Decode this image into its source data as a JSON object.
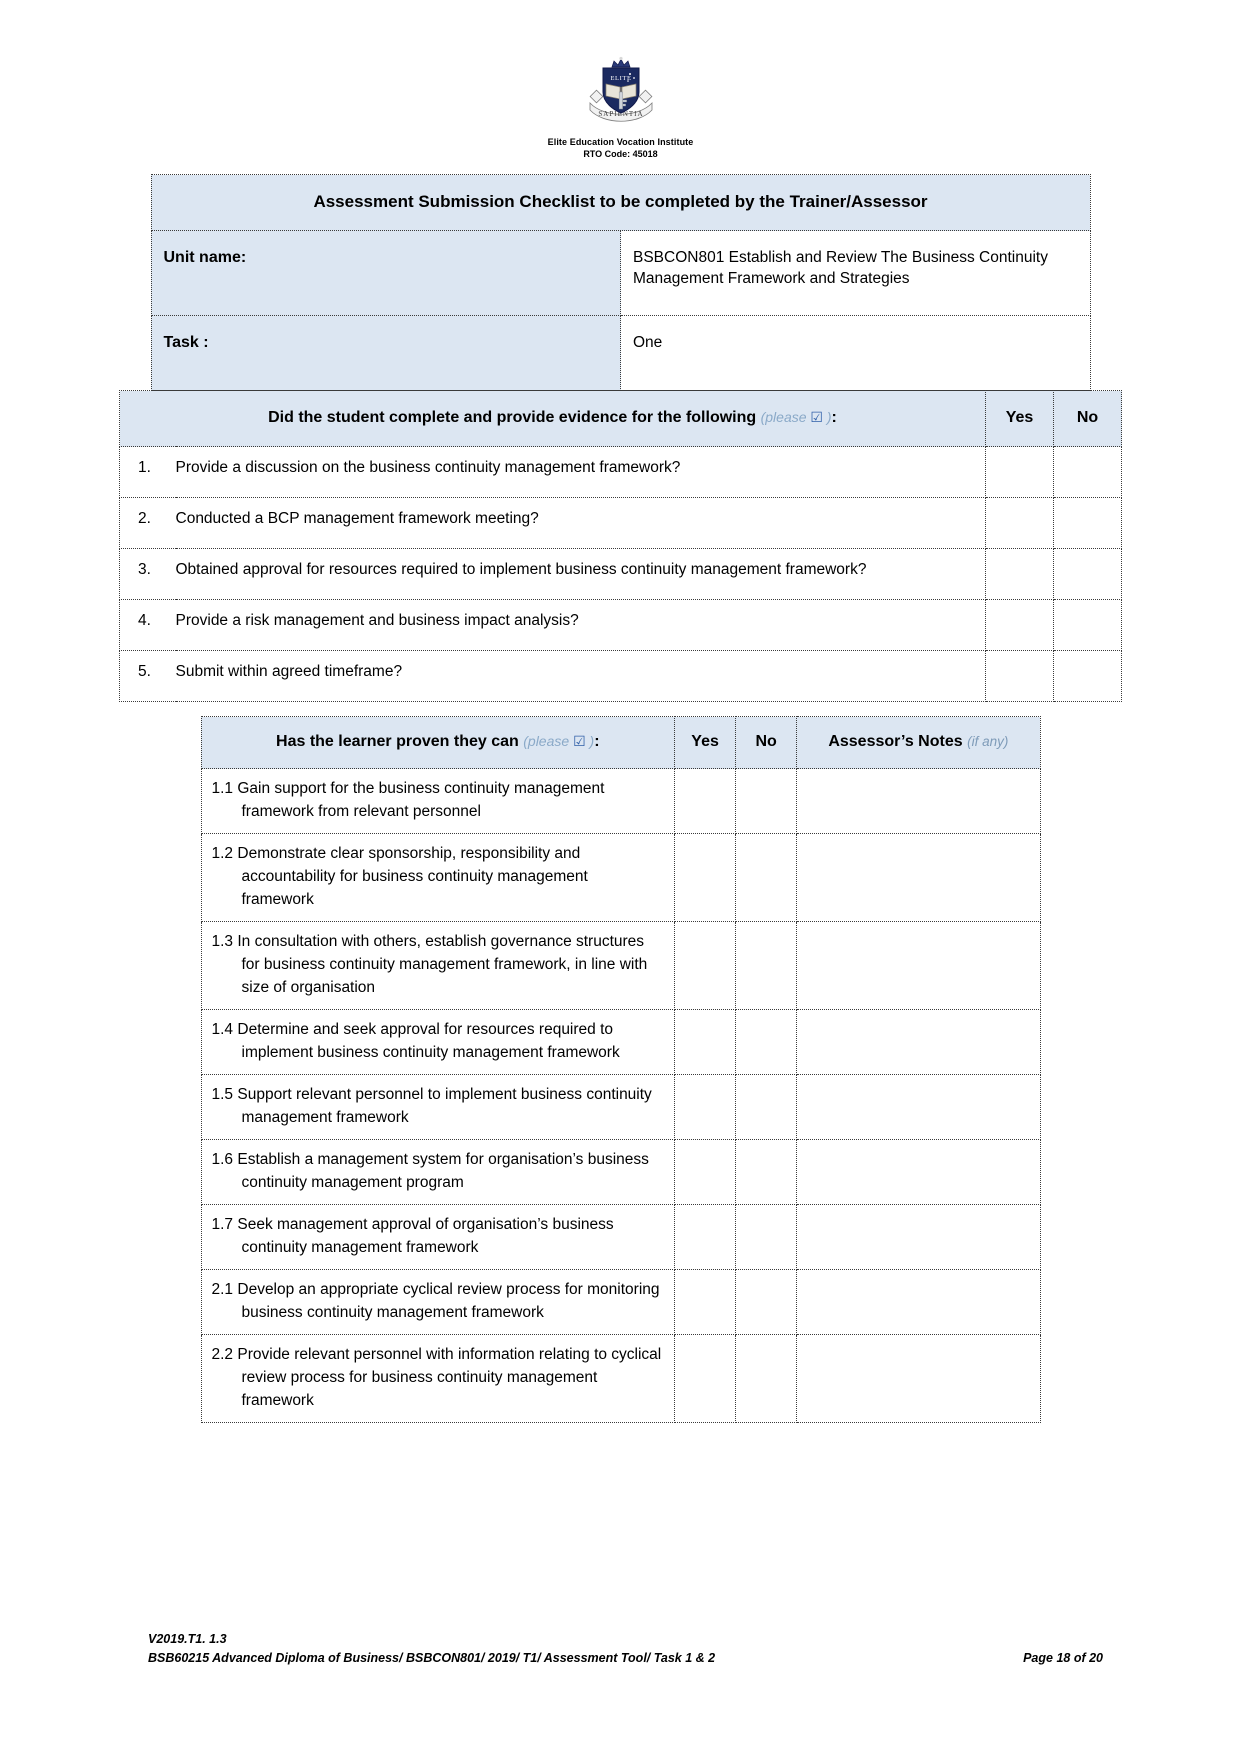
{
  "header": {
    "logo_icon": "elite-crest-icon",
    "crest_motto": "SAPIENTIA",
    "crest_word": "ELITE",
    "org_name": "Elite Education Vocation Institute",
    "rto_code": "RTO Code: 45018"
  },
  "checklist_table": {
    "title": "Assessment Submission Checklist to be completed by the Trainer/Assessor",
    "unit_label": "Unit name:",
    "unit_value": "BSBCON801 Establish and Review The Business Continuity Management Framework and Strategies",
    "task_label": "Task :",
    "task_value": "One"
  },
  "evidence_table": {
    "question_header": "Did the student complete and provide evidence for the following",
    "question_hint": "(please ",
    "question_hint_check": "☑",
    "question_hint_close": " )",
    "question_colon": ":",
    "yes_header": "Yes",
    "no_header": "No",
    "items": [
      {
        "number": "1.",
        "text": "Provide a discussion on the business continuity management framework?",
        "yes": "",
        "no": ""
      },
      {
        "number": "2.",
        "text": "Conducted a BCP management framework meeting?",
        "yes": "",
        "no": ""
      },
      {
        "number": "3.",
        "text": "Obtained approval for resources required to implement business continuity management framework?",
        "yes": "",
        "no": ""
      },
      {
        "number": "4.",
        "text": "Provide a risk management and business impact analysis?",
        "yes": "",
        "no": ""
      },
      {
        "number": "5.",
        "text": "Submit within agreed timeframe?",
        "yes": "",
        "no": ""
      }
    ]
  },
  "criteria_table": {
    "question_header": "Has the learner proven they can",
    "question_hint": "(please ",
    "question_hint_check": "☑",
    "question_hint_close": " )",
    "question_colon": ":",
    "yes_header": "Yes",
    "no_header": "No",
    "notes_header": "Assessor’s Notes",
    "notes_hint": "(if any)",
    "rows": [
      {
        "code": "1.1",
        "text": "Gain support for the business continuity management framework from relevant personnel",
        "yes": "",
        "no": "",
        "notes": ""
      },
      {
        "code": "1.2",
        "text": "Demonstrate clear sponsorship, responsibility and accountability for business continuity management framework",
        "yes": "",
        "no": "",
        "notes": ""
      },
      {
        "code": "1.3",
        "text": "In consultation with others, establish governance structures for business continuity management framework, in line with size of organisation",
        "yes": "",
        "no": "",
        "notes": ""
      },
      {
        "code": "1.4",
        "text": "Determine and seek approval for resources required to implement business continuity management framework",
        "yes": "",
        "no": "",
        "notes": ""
      },
      {
        "code": "1.5",
        "text": "Support relevant personnel to implement business continuity management framework",
        "yes": "",
        "no": "",
        "notes": ""
      },
      {
        "code": "1.6",
        "text": "Establish a management system for organisation’s business continuity management program",
        "yes": "",
        "no": "",
        "notes": ""
      },
      {
        "code": "1.7",
        "text": "Seek management approval of organisation’s business continuity management framework",
        "yes": "",
        "no": "",
        "notes": ""
      },
      {
        "code": "2.1",
        "text": "Develop an appropriate cyclical review process for monitoring business continuity management framework",
        "yes": "",
        "no": "",
        "notes": ""
      },
      {
        "code": "2.2",
        "text": "Provide relevant personnel with information relating to cyclical review process for business continuity management framework",
        "yes": "",
        "no": "",
        "notes": ""
      }
    ]
  },
  "footer": {
    "version": "V2019.T1. 1.3",
    "course_line": "BSB60215 Advanced Diploma of Business/ BSBCON801/ 2019/ T1/ Assessment Tool/ Task 1 & 2",
    "page_number": "Page 18 of 20"
  },
  "colors": {
    "header_fill": "#dce6f2",
    "border": "#3a3a3a",
    "hint_text": "#8aa9c8",
    "check_mark": "#2f5fa8"
  }
}
